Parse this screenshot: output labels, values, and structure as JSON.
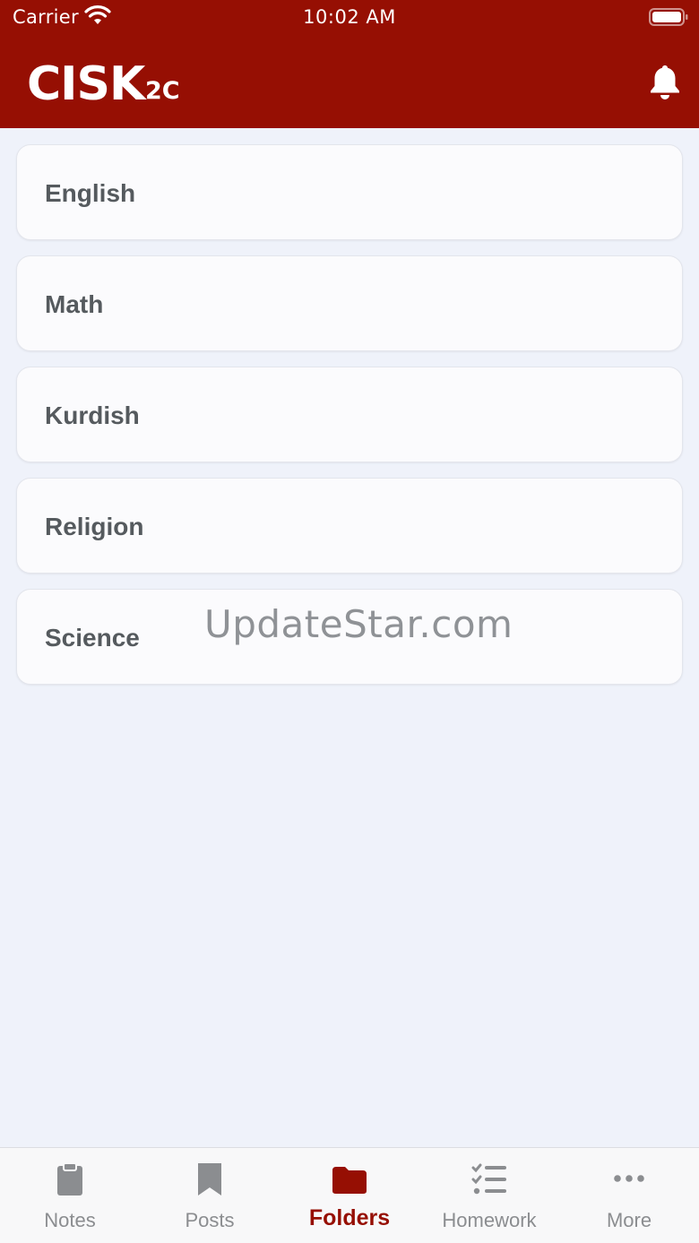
{
  "status_bar": {
    "carrier": "Carrier",
    "time": "10:02 AM"
  },
  "header": {
    "title": "CISK",
    "subtitle": "2C",
    "bell_icon": "bell-icon"
  },
  "subjects": [
    {
      "label": "English"
    },
    {
      "label": "Math"
    },
    {
      "label": "Kurdish"
    },
    {
      "label": "Religion"
    },
    {
      "label": "Science"
    }
  ],
  "watermark": "UpdateStar.com",
  "tabs": [
    {
      "label": "Notes",
      "icon": "clipboard-icon",
      "active": false
    },
    {
      "label": "Posts",
      "icon": "bookmark-icon",
      "active": false
    },
    {
      "label": "Folders",
      "icon": "folder-icon",
      "active": true
    },
    {
      "label": "Homework",
      "icon": "checklist-icon",
      "active": false
    },
    {
      "label": "More",
      "icon": "ellipsis-icon",
      "active": false
    }
  ],
  "colors": {
    "brand": "#960f03",
    "background": "#eff2fa",
    "tab_inactive": "#8b8d90"
  }
}
